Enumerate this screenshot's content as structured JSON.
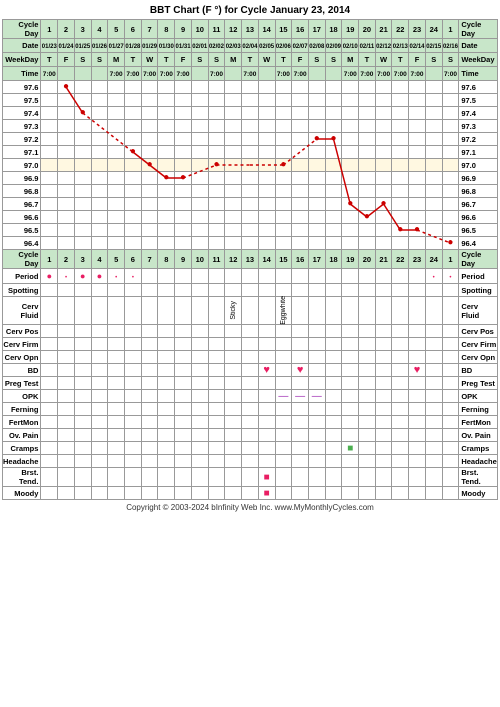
{
  "title": "BBT Chart (F °) for Cycle January 23, 2014",
  "cycleDays": [
    1,
    2,
    3,
    4,
    5,
    6,
    7,
    8,
    9,
    10,
    11,
    12,
    13,
    14,
    15,
    16,
    17,
    18,
    19,
    20,
    21,
    22,
    23,
    24,
    1
  ],
  "dates": [
    "01/23",
    "01/24",
    "01/25",
    "01/26",
    "01/27",
    "01/28",
    "01/29",
    "01/30",
    "01/31",
    "02/01",
    "02/02",
    "02/03",
    "02/04",
    "02/05",
    "02/06",
    "02/07",
    "02/08",
    "02/09",
    "02/10",
    "02/11",
    "02/12",
    "02/13",
    "02/14",
    "02/15",
    "02/16"
  ],
  "weekdays": [
    "T",
    "F",
    "S",
    "S",
    "M",
    "T",
    "W",
    "T",
    "F",
    "S",
    "S",
    "M",
    "T",
    "W",
    "T",
    "F",
    "S",
    "S",
    "M",
    "T",
    "W",
    "T",
    "F",
    "S",
    "S"
  ],
  "times": [
    "7:00",
    "",
    "",
    "",
    "7:00",
    "7:00",
    "7:00",
    "7:00",
    "7:00",
    "",
    "7:00",
    "",
    "7:00",
    "",
    "7:00",
    "7:00",
    "",
    "",
    "7:00",
    "7:00",
    "7:00",
    "7:00",
    "7:00",
    "",
    "7:00"
  ],
  "temps": {
    "97.6": [
      null,
      1,
      null,
      null,
      null,
      null,
      null,
      null,
      null,
      null,
      null,
      null,
      null,
      null,
      null,
      null,
      null,
      null,
      null,
      null,
      null,
      null,
      null,
      null,
      null
    ],
    "97.5": [
      null,
      null,
      null,
      null,
      null,
      null,
      null,
      null,
      null,
      null,
      null,
      null,
      null,
      null,
      null,
      null,
      null,
      null,
      null,
      null,
      null,
      null,
      null,
      null,
      null
    ],
    "97.4": [
      null,
      null,
      1,
      null,
      null,
      null,
      null,
      null,
      null,
      null,
      null,
      null,
      null,
      null,
      null,
      null,
      null,
      null,
      null,
      null,
      null,
      null,
      null,
      null,
      null
    ],
    "97.3": [
      null,
      null,
      null,
      null,
      null,
      null,
      null,
      null,
      null,
      null,
      null,
      null,
      null,
      null,
      null,
      null,
      null,
      null,
      null,
      null,
      null,
      null,
      null,
      null,
      null
    ],
    "97.2": [
      null,
      null,
      null,
      null,
      null,
      null,
      null,
      null,
      null,
      null,
      null,
      null,
      null,
      null,
      null,
      null,
      1,
      1,
      null,
      null,
      null,
      null,
      null,
      null,
      null
    ],
    "97.1": [
      null,
      null,
      null,
      null,
      null,
      1,
      null,
      null,
      null,
      null,
      null,
      null,
      null,
      null,
      null,
      null,
      null,
      null,
      null,
      null,
      null,
      null,
      null,
      null,
      null
    ],
    "97.0": [
      null,
      null,
      null,
      null,
      null,
      null,
      1,
      null,
      null,
      null,
      1,
      null,
      null,
      null,
      1,
      null,
      null,
      null,
      null,
      null,
      null,
      null,
      null,
      null,
      null
    ],
    "96.9": [
      null,
      null,
      null,
      null,
      null,
      null,
      null,
      1,
      1,
      null,
      null,
      null,
      null,
      null,
      null,
      null,
      null,
      null,
      null,
      null,
      null,
      null,
      null,
      null,
      null
    ],
    "96.8": [
      null,
      null,
      null,
      null,
      null,
      null,
      null,
      null,
      null,
      null,
      null,
      null,
      null,
      null,
      null,
      null,
      null,
      null,
      null,
      null,
      null,
      null,
      null,
      null,
      null
    ],
    "96.7": [
      null,
      null,
      null,
      null,
      null,
      null,
      null,
      null,
      null,
      null,
      null,
      null,
      null,
      null,
      null,
      null,
      null,
      null,
      1,
      null,
      1,
      null,
      null,
      null,
      null
    ],
    "96.6": [
      null,
      null,
      null,
      null,
      null,
      null,
      null,
      null,
      null,
      null,
      null,
      null,
      null,
      null,
      null,
      null,
      null,
      null,
      null,
      1,
      null,
      null,
      null,
      null,
      null
    ],
    "96.5": [
      null,
      null,
      null,
      null,
      null,
      null,
      null,
      null,
      null,
      null,
      null,
      null,
      null,
      null,
      null,
      null,
      null,
      null,
      null,
      null,
      null,
      1,
      1,
      null,
      null
    ],
    "96.4": [
      null,
      null,
      null,
      null,
      null,
      null,
      null,
      null,
      null,
      null,
      null,
      null,
      null,
      null,
      null,
      null,
      null,
      null,
      null,
      null,
      null,
      null,
      null,
      null,
      1
    ]
  },
  "tempValues": {
    "2": 97.6,
    "3": 97.4,
    "6": 97.1,
    "7": 97.0,
    "8": 96.9,
    "9": 96.9,
    "11": 97.0,
    "13": 97.0,
    "15": 97.0,
    "17": 97.2,
    "18": 97.2,
    "19": 96.7,
    "20": 96.6,
    "21": 96.7,
    "22": 96.5,
    "23": 96.5,
    "25": 96.4
  },
  "period": {
    "1": "circle-filled",
    "2": "dot",
    "3": "circle-filled",
    "4": "circle-filled",
    "5": "dot",
    "6": "dot",
    "24": "dot",
    "25": "dot"
  },
  "bd": {
    "14": "heart",
    "16": "heart",
    "23": "heart"
  },
  "opk": {
    "15": "dash",
    "16": "dash",
    "17": "dash"
  },
  "cervFluid": {
    "12": "Sticky",
    "15": "Eggwhite"
  },
  "cramps": {
    "19": "green-sq"
  },
  "brst_tend": {
    "14": "pink-sq"
  },
  "moody": {
    "14": "pink-sq"
  },
  "labels": {
    "cycleDay": "Cycle Day",
    "date": "Date",
    "weekDay": "WeekDay",
    "time": "Time",
    "period": "Period",
    "spotting": "Spotting",
    "cervFluid": "Cerv Fluid",
    "cervPos": "Cerv Pos",
    "cervFirm": "Cerv Firm",
    "cervOpn": "Cerv Opn",
    "bd": "BD",
    "pregTest": "Preg Test",
    "opk": "OPK",
    "ferning": "Ferning",
    "fertMon": "FertMon",
    "ovPain": "Ov. Pain",
    "cramps": "Cramps",
    "headache": "Headache",
    "brstTend": "Brst. Tend.",
    "moody": "Moody"
  },
  "copyright": "Copyright © 2003-2024 bInfinity Web Inc.   www.MyMonthlyCycles.com"
}
